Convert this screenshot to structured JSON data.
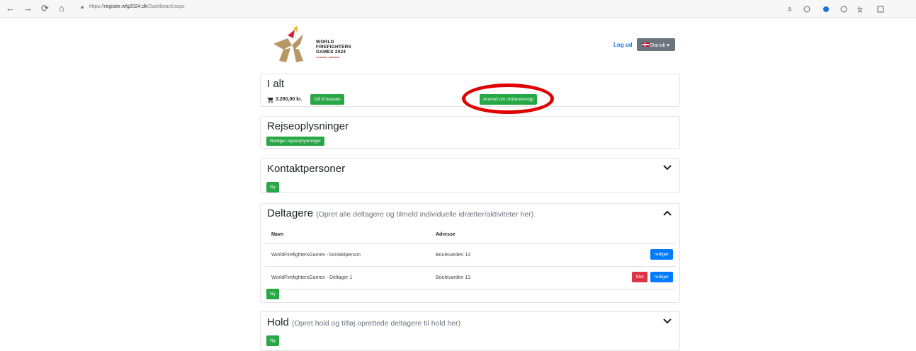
{
  "browser": {
    "url_prefix": "https://",
    "url_host": "register.wfg2024.dk",
    "url_path": "/Dashboard.aspx",
    "back_icon": "←",
    "forward_icon": "→",
    "refresh_icon": "⟳",
    "home_icon": "⌂"
  },
  "header": {
    "logo_line1": "WORLD",
    "logo_line2": "FIREFIGHTERS",
    "logo_line3": "GAMES 2024",
    "logo_sub": "AALBORG · DENMARK",
    "logout": "Log ud",
    "language": "Dansk"
  },
  "total": {
    "title": "I alt",
    "amount": "3.260,00 kr.",
    "checkout": "Gå til kassen",
    "request": "Anmod om ordreoversigt"
  },
  "travel": {
    "title": "Rejseoplysninger",
    "edit": "Rediger rejseoplysninger"
  },
  "contacts": {
    "title": "Kontaktpersoner",
    "new": "Ny"
  },
  "participants": {
    "title": "Deltagere",
    "hint": "(Opret alle deltagere og tilmeld individuelle idrætter/aktiviteter her)",
    "col_name": "Navn",
    "col_address": "Adresse",
    "rows": [
      {
        "name": "WorldFirefightersGames - kontaktperson",
        "address": "Boulevarden 13",
        "edit": "rediger"
      },
      {
        "name": "WorldFirefightersGames - Deltager 1",
        "address": "Boulevarden 13",
        "delete": "Slet",
        "edit": "rediger"
      }
    ],
    "new": "Ny"
  },
  "teams": {
    "title": "Hold",
    "hint": "(Opret hold og tilføj oprettede deltagere til hold her)",
    "new": "Ny"
  },
  "colors": {
    "green": "#28a745",
    "blue": "#007bff",
    "red": "#dc3545",
    "highlight": "#e00000"
  }
}
